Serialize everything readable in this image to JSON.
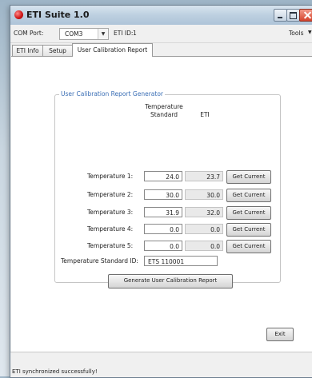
{
  "window": {
    "title": "ETI Suite 1.0"
  },
  "toolbar": {
    "com_port_label": "COM Port:",
    "com_port_value": "COM3",
    "eti_id_label": "ETI ID:",
    "eti_id_value": "1",
    "tools_menu": "Tools"
  },
  "tabs": [
    {
      "label": "ETI Info",
      "active": false
    },
    {
      "label": "Setup",
      "active": false
    },
    {
      "label": "User Calibration Report",
      "active": true
    }
  ],
  "report": {
    "group_title": "User Calibration Report Generator",
    "col_standard_line1": "Temperature",
    "col_standard_line2": "Standard",
    "col_eti": "ETI",
    "rows": [
      {
        "label": "Temperature 1:",
        "standard": "24.0",
        "eti": "23.7",
        "button": "Get Current"
      },
      {
        "label": "Temperature 2:",
        "standard": "30.0",
        "eti": "30.0",
        "button": "Get Current"
      },
      {
        "label": "Temperature 3:",
        "standard": "31.9",
        "eti": "32.0",
        "button": "Get Current"
      },
      {
        "label": "Temperature 4:",
        "standard": "0.0",
        "eti": "0.0",
        "button": "Get Current"
      },
      {
        "label": "Temperature 5:",
        "standard": "0.0",
        "eti": "0.0",
        "button": "Get Current"
      }
    ],
    "standard_id_label": "Temperature Standard ID:",
    "standard_id_value": "ETS 110001",
    "generate_button": "Generate User Calibration Report"
  },
  "exit_button": "Exit",
  "status": {
    "text": "ETI synchronized successfully!"
  },
  "colors": {
    "group_title": "#3a6eb5",
    "close_button": "#d4432c"
  },
  "icons": [
    "app-icon",
    "minimize-icon",
    "maximize-icon",
    "close-icon",
    "dropdown-arrow-icon",
    "menu-arrow-icon"
  ]
}
